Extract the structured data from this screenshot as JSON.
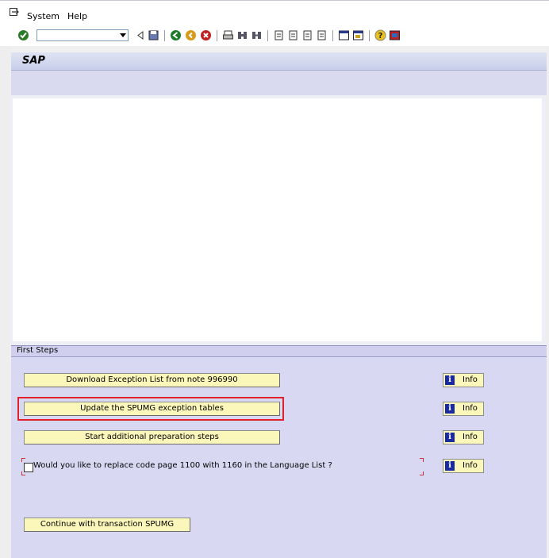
{
  "menubar": {
    "items": [
      "System",
      "Help"
    ]
  },
  "toolbar": {
    "command_field_value": ""
  },
  "title_bar": {
    "title": "SAP"
  },
  "first_steps": {
    "header": "First Steps",
    "buttons": [
      "Download Exception List from note 996990",
      "Update the SPUMG exception tables",
      "Start additional preparation steps"
    ],
    "checkbox_label": "Would you like to replace code page 1100 with 1160 in the Language List ?",
    "checkbox_checked": false,
    "info_label": "Info",
    "continue_button": "Continue with transaction SPUMG"
  },
  "colors": {
    "button_yellow": "#fbf6b9",
    "panel_lavender": "#d8d8f2",
    "highlight_red": "#e0202a"
  }
}
